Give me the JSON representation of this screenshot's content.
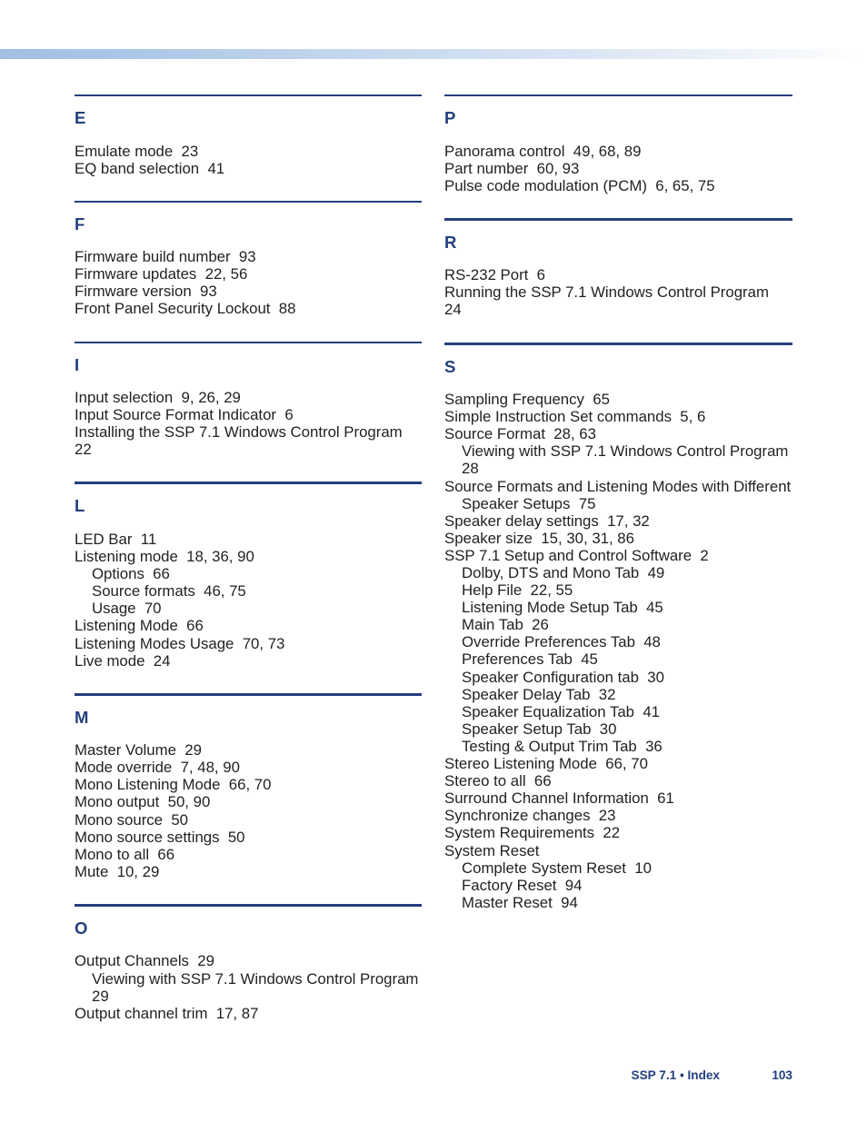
{
  "document": {
    "type": "index-page",
    "accent_color": "#23407e",
    "banner_color_left": "#a0bfe3",
    "banner_color_right": "#ffffff"
  },
  "footer": {
    "title": "SSP 7.1 • Index",
    "page_number": "103"
  },
  "columns": {
    "left": [
      {
        "letter": "E",
        "rule": "thin",
        "entries": [
          {
            "level": "main",
            "text": "Emulate mode  23"
          },
          {
            "level": "main",
            "text": "EQ band selection  41"
          }
        ]
      },
      {
        "letter": "F",
        "rule": "thin",
        "entries": [
          {
            "level": "main",
            "text": "Firmware build number  93"
          },
          {
            "level": "main",
            "text": "Firmware updates  22, 56"
          },
          {
            "level": "main",
            "text": "Firmware version  93"
          },
          {
            "level": "main",
            "text": "Front Panel Security Lockout  88"
          }
        ]
      },
      {
        "letter": "I",
        "rule": "thin",
        "entries": [
          {
            "level": "main",
            "text": "Input selection  9, 26, 29"
          },
          {
            "level": "main",
            "text": "Input Source Format Indicator  6"
          },
          {
            "level": "main",
            "text": "Installing the SSP 7.1 Windows Control Program  22"
          }
        ]
      },
      {
        "letter": "L",
        "rule": "thick",
        "entries": [
          {
            "level": "main",
            "text": "LED Bar  11"
          },
          {
            "level": "main",
            "text": "Listening mode  18, 36, 90"
          },
          {
            "level": "sub",
            "text": "Options  66"
          },
          {
            "level": "sub",
            "text": "Source formats  46, 75"
          },
          {
            "level": "sub",
            "text": "Usage  70"
          },
          {
            "level": "main",
            "text": "Listening Mode  66"
          },
          {
            "level": "main",
            "text": "Listening Modes Usage  70, 73"
          },
          {
            "level": "main",
            "text": "Live mode  24"
          }
        ]
      },
      {
        "letter": "M",
        "rule": "thick",
        "entries": [
          {
            "level": "main",
            "text": "Master Volume  29"
          },
          {
            "level": "main",
            "text": "Mode override  7, 48, 90"
          },
          {
            "level": "main",
            "text": "Mono Listening Mode  66, 70"
          },
          {
            "level": "main",
            "text": "Mono output  50, 90"
          },
          {
            "level": "main",
            "text": "Mono source  50"
          },
          {
            "level": "main",
            "text": "Mono source settings  50"
          },
          {
            "level": "main",
            "text": "Mono to all  66"
          },
          {
            "level": "main",
            "text": "Mute  10, 29"
          }
        ]
      },
      {
        "letter": "O",
        "rule": "thick",
        "entries": [
          {
            "level": "main",
            "text": "Output Channels  29"
          },
          {
            "level": "sub",
            "text": "Viewing with SSP 7.1 Windows Control Program  29"
          },
          {
            "level": "main",
            "text": "Output channel trim  17, 87"
          }
        ]
      }
    ],
    "right": [
      {
        "letter": "P",
        "rule": "thin",
        "entries": [
          {
            "level": "main",
            "text": "Panorama control  49, 68, 89"
          },
          {
            "level": "main",
            "text": "Part number  60, 93"
          },
          {
            "level": "main",
            "text": "Pulse code modulation (PCM)  6, 65, 75"
          }
        ]
      },
      {
        "letter": "R",
        "rule": "thick",
        "entries": [
          {
            "level": "main",
            "text": "RS-232 Port  6"
          },
          {
            "level": "main",
            "text": "Running the SSP 7.1 Windows Control Program  24"
          }
        ]
      },
      {
        "letter": "S",
        "rule": "thick",
        "entries": [
          {
            "level": "main",
            "text": "Sampling Frequency  65"
          },
          {
            "level": "main",
            "text": "Simple Instruction Set commands  5, 6"
          },
          {
            "level": "main",
            "text": "Source Format  28, 63"
          },
          {
            "level": "sub",
            "text": "Viewing with SSP 7.1 Windows Control Program  28"
          },
          {
            "level": "main",
            "text": "Source Formats and Listening Modes with Different"
          },
          {
            "level": "cont",
            "text": "Speaker Setups  75"
          },
          {
            "level": "main",
            "text": "Speaker delay settings  17, 32"
          },
          {
            "level": "main",
            "text": "Speaker size  15, 30, 31, 86"
          },
          {
            "level": "main",
            "text": "SSP 7.1 Setup and Control Software  2"
          },
          {
            "level": "sub",
            "text": "Dolby, DTS and Mono Tab  49"
          },
          {
            "level": "sub",
            "text": "Help File  22, 55"
          },
          {
            "level": "sub",
            "text": "Listening Mode Setup Tab  45"
          },
          {
            "level": "sub",
            "text": "Main Tab  26"
          },
          {
            "level": "sub",
            "text": "Override Preferences Tab  48"
          },
          {
            "level": "sub",
            "text": "Preferences Tab  45"
          },
          {
            "level": "sub",
            "text": "Speaker Configuration tab  30"
          },
          {
            "level": "sub",
            "text": "Speaker Delay Tab  32"
          },
          {
            "level": "sub",
            "text": "Speaker Equalization Tab  41"
          },
          {
            "level": "sub",
            "text": "Speaker Setup Tab  30"
          },
          {
            "level": "sub",
            "text": "Testing & Output Trim Tab  36"
          },
          {
            "level": "main",
            "text": "Stereo Listening Mode  66, 70"
          },
          {
            "level": "main",
            "text": "Stereo to all  66"
          },
          {
            "level": "main",
            "text": "Surround Channel Information  61"
          },
          {
            "level": "main",
            "text": "Synchronize changes  23"
          },
          {
            "level": "main",
            "text": "System Requirements  22"
          },
          {
            "level": "main",
            "text": "System Reset"
          },
          {
            "level": "sub",
            "text": "Complete System Reset  10"
          },
          {
            "level": "sub",
            "text": "Factory Reset  94"
          },
          {
            "level": "sub",
            "text": "Master Reset  94"
          }
        ]
      }
    ]
  }
}
